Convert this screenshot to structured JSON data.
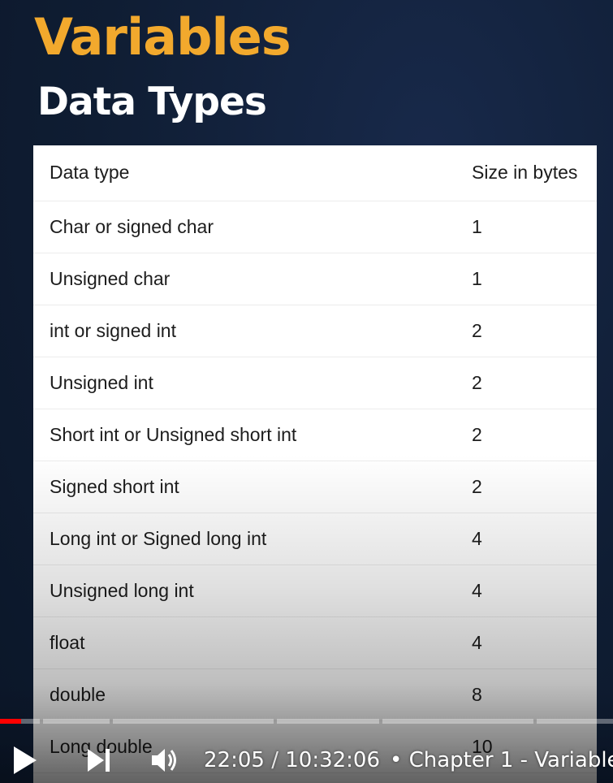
{
  "slide": {
    "title": "Variables",
    "subtitle": "Data Types",
    "table": {
      "headers": [
        "Data type",
        "Size in bytes"
      ],
      "rows": [
        [
          "Char or signed char",
          "1"
        ],
        [
          "Unsigned char",
          "1"
        ],
        [
          "int or signed int",
          "2"
        ],
        [
          "Unsigned int",
          "2"
        ],
        [
          "Short int or Unsigned short int",
          "2"
        ],
        [
          "Signed short int",
          "2"
        ],
        [
          "Long int or Signed long int",
          "4"
        ],
        [
          "Unsigned long int",
          "4"
        ],
        [
          "float",
          "4"
        ],
        [
          "double",
          "8"
        ],
        [
          "Long double",
          "10"
        ]
      ]
    }
  },
  "player": {
    "current_time": "22:05",
    "separator": "/",
    "duration": "10:32:06",
    "chapter_bullet": "•",
    "chapter_title": "Chapter 1 - Variable",
    "progress_fraction": 0.035,
    "icons": {
      "play": "play-icon",
      "next": "next-icon",
      "volume": "volume-icon"
    },
    "colors": {
      "progress_played": "#ff0000",
      "title_accent": "#f2a92d"
    }
  }
}
